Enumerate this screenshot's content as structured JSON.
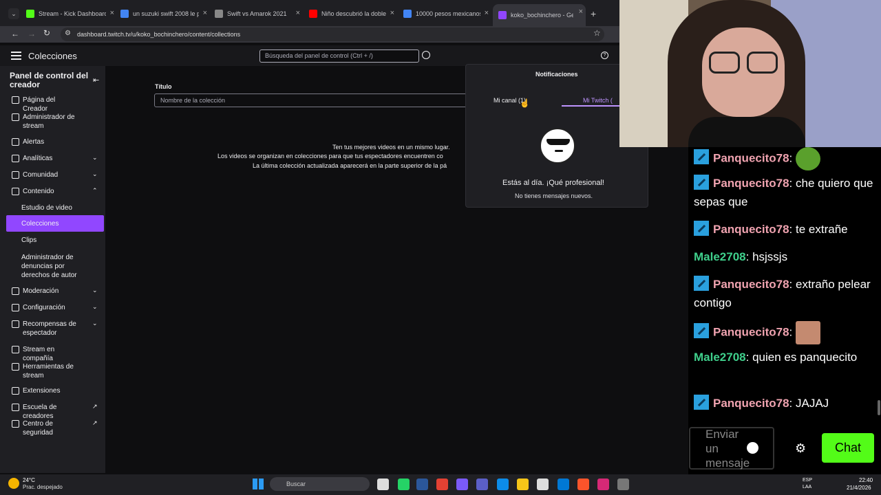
{
  "browser": {
    "tabs": [
      {
        "label": "Stream - Kick Dashboard",
        "color": "#53fc18"
      },
      {
        "label": "un suzuki swift 2008 le p",
        "color": "#4285f4"
      },
      {
        "label": "Swift vs Amarok 2021",
        "color": "#888888"
      },
      {
        "label": "Niño descubrió la doble",
        "color": "#ff0000"
      },
      {
        "label": "10000 pesos mexicanos",
        "color": "#4285f4"
      },
      {
        "label": "koko_bochinchero - Gest",
        "color": "#9146ff"
      }
    ],
    "url": "dashboard.twitch.tv/u/koko_bochinchero/content/collections"
  },
  "topbar": {
    "title": "Colecciones",
    "search_placeholder": "Búsqueda del panel de control (Ctrl + /)"
  },
  "sidebar": {
    "heading": "Panel de control del creador",
    "items": [
      {
        "label": "Página del Creador",
        "chev": ""
      },
      {
        "label": "Administrador de stream",
        "chev": ""
      },
      {
        "label": "Alertas",
        "chev": ""
      },
      {
        "label": "Analíticas",
        "chev": "⌄"
      },
      {
        "label": "Comunidad",
        "chev": "⌄"
      },
      {
        "label": "Contenido",
        "chev": "⌃"
      },
      {
        "label": "Estudio de video",
        "chev": ""
      },
      {
        "label": "Colecciones",
        "chev": ""
      },
      {
        "label": "Clips",
        "chev": ""
      },
      {
        "label": "Administrador de denuncias por derechos de autor",
        "chev": ""
      },
      {
        "label": "Moderación",
        "chev": "⌄"
      },
      {
        "label": "Configuración",
        "chev": "⌄"
      },
      {
        "label": "Recompensas de espectador",
        "chev": "⌄"
      },
      {
        "label": "Stream en compañía",
        "chev": ""
      },
      {
        "label": "Herramientas de stream",
        "chev": ""
      },
      {
        "label": "Extensiones",
        "chev": ""
      },
      {
        "label": "Escuela de creadores",
        "chev": "↗"
      },
      {
        "label": "Centro de seguridad",
        "chev": "↗"
      }
    ]
  },
  "main": {
    "title_label": "Título",
    "title_placeholder": "Nombre de la colección",
    "empty_line1": "Ten tus mejores videos en un mismo lugar.",
    "empty_line2": "Los videos se organizan en colecciones para que tus espectadores encuentren co",
    "empty_line3": "La última colección actualizada aparecerá en la parte superior de la pá"
  },
  "notifications": {
    "title": "Notificaciones",
    "tab_channel": "Mi canal (1)",
    "tab_twitch": "Mi Twitch (",
    "headline": "Estás al día. ¡Qué profesional!",
    "sub": "No tienes mensajes nuevos."
  },
  "chat": {
    "messages": [
      {
        "user": "Panquecito78",
        "text": "",
        "badge": true,
        "emote": "melon"
      },
      {
        "user": "Panquecito78",
        "text": "che quiero que sepas que",
        "badge": true
      },
      {
        "user": "Panquecito78",
        "text": "te extrañe",
        "badge": true
      },
      {
        "user": "Male2708",
        "text": "hsjssjs",
        "badge": false
      },
      {
        "user": "Panquecito78",
        "text": "extraño pelear contigo",
        "badge": true
      },
      {
        "user": "Panquecito78",
        "text": "",
        "badge": true,
        "emote": "face"
      },
      {
        "user": "Male2708",
        "text": "quien es panquecito",
        "badge": false
      },
      {
        "user": "Panquecito78",
        "text": "JAJAJ",
        "badge": true
      }
    ],
    "input_placeholder": "Enviar un mensaje",
    "send_label": "Chat"
  },
  "taskbar": {
    "weather_temp": "24°C",
    "weather_desc": "Prac. despejado",
    "search_label": "Buscar",
    "lang1": "ESP",
    "lang2": "LAA",
    "time": "22:40",
    "date": "21/4/2026"
  }
}
